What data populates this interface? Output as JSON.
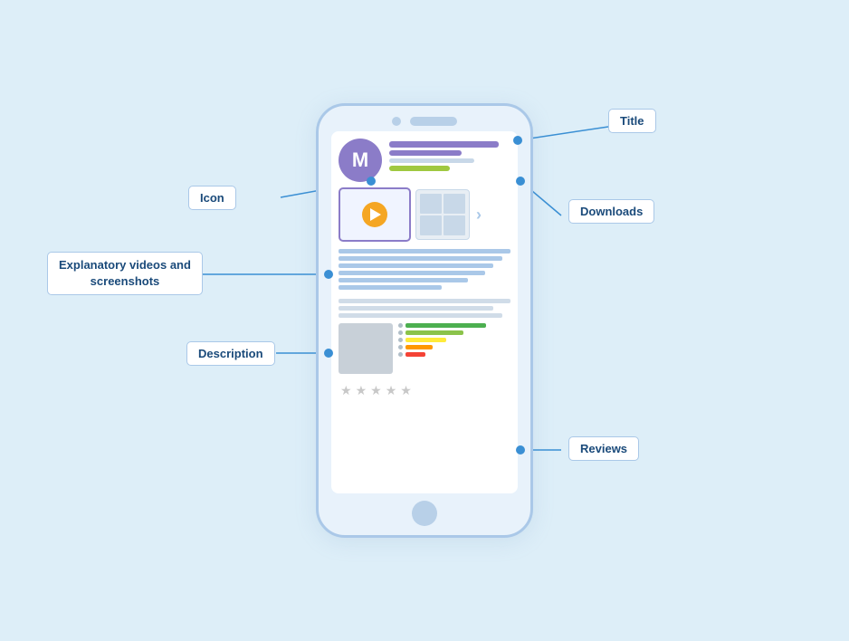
{
  "labels": {
    "title": "Title",
    "icon": "Icon",
    "downloads": "Downloads",
    "explanatory": "Explanatory videos and\nscreenshots",
    "description": "Description",
    "reviews": "Reviews"
  },
  "phone": {
    "app_icon_letter": "M"
  },
  "review_bars": [
    {
      "color": "#4caf50",
      "width": "72%"
    },
    {
      "color": "#8bc34a",
      "width": "52%"
    },
    {
      "color": "#ffeb3b",
      "width": "36%"
    },
    {
      "color": "#ff9800",
      "width": "24%"
    },
    {
      "color": "#f44336",
      "width": "18%"
    }
  ],
  "stars_count": 5,
  "accent_color": "#3a8fd4",
  "connector_color": "#3a8fd4"
}
